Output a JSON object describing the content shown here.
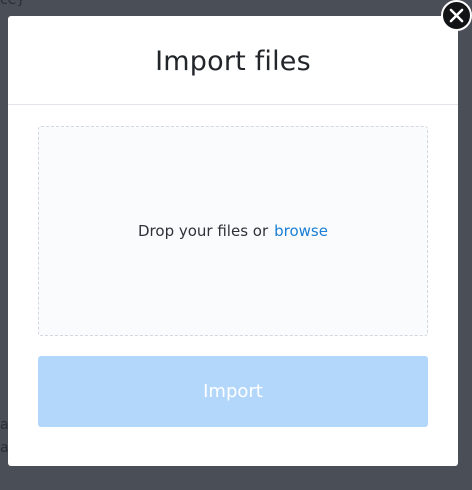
{
  "background": {
    "top_text": "ce}",
    "left_text_1": "a",
    "left_text_2": "a"
  },
  "modal": {
    "title": "Import files",
    "dropzone": {
      "prompt": "Drop your files or",
      "browse_label": "browse"
    },
    "import_label": "Import",
    "close_icon": "close-icon"
  },
  "colors": {
    "accent": "#1a7fd4",
    "button_disabled": "#b3d7fb",
    "overlay": "#4a4e57"
  }
}
